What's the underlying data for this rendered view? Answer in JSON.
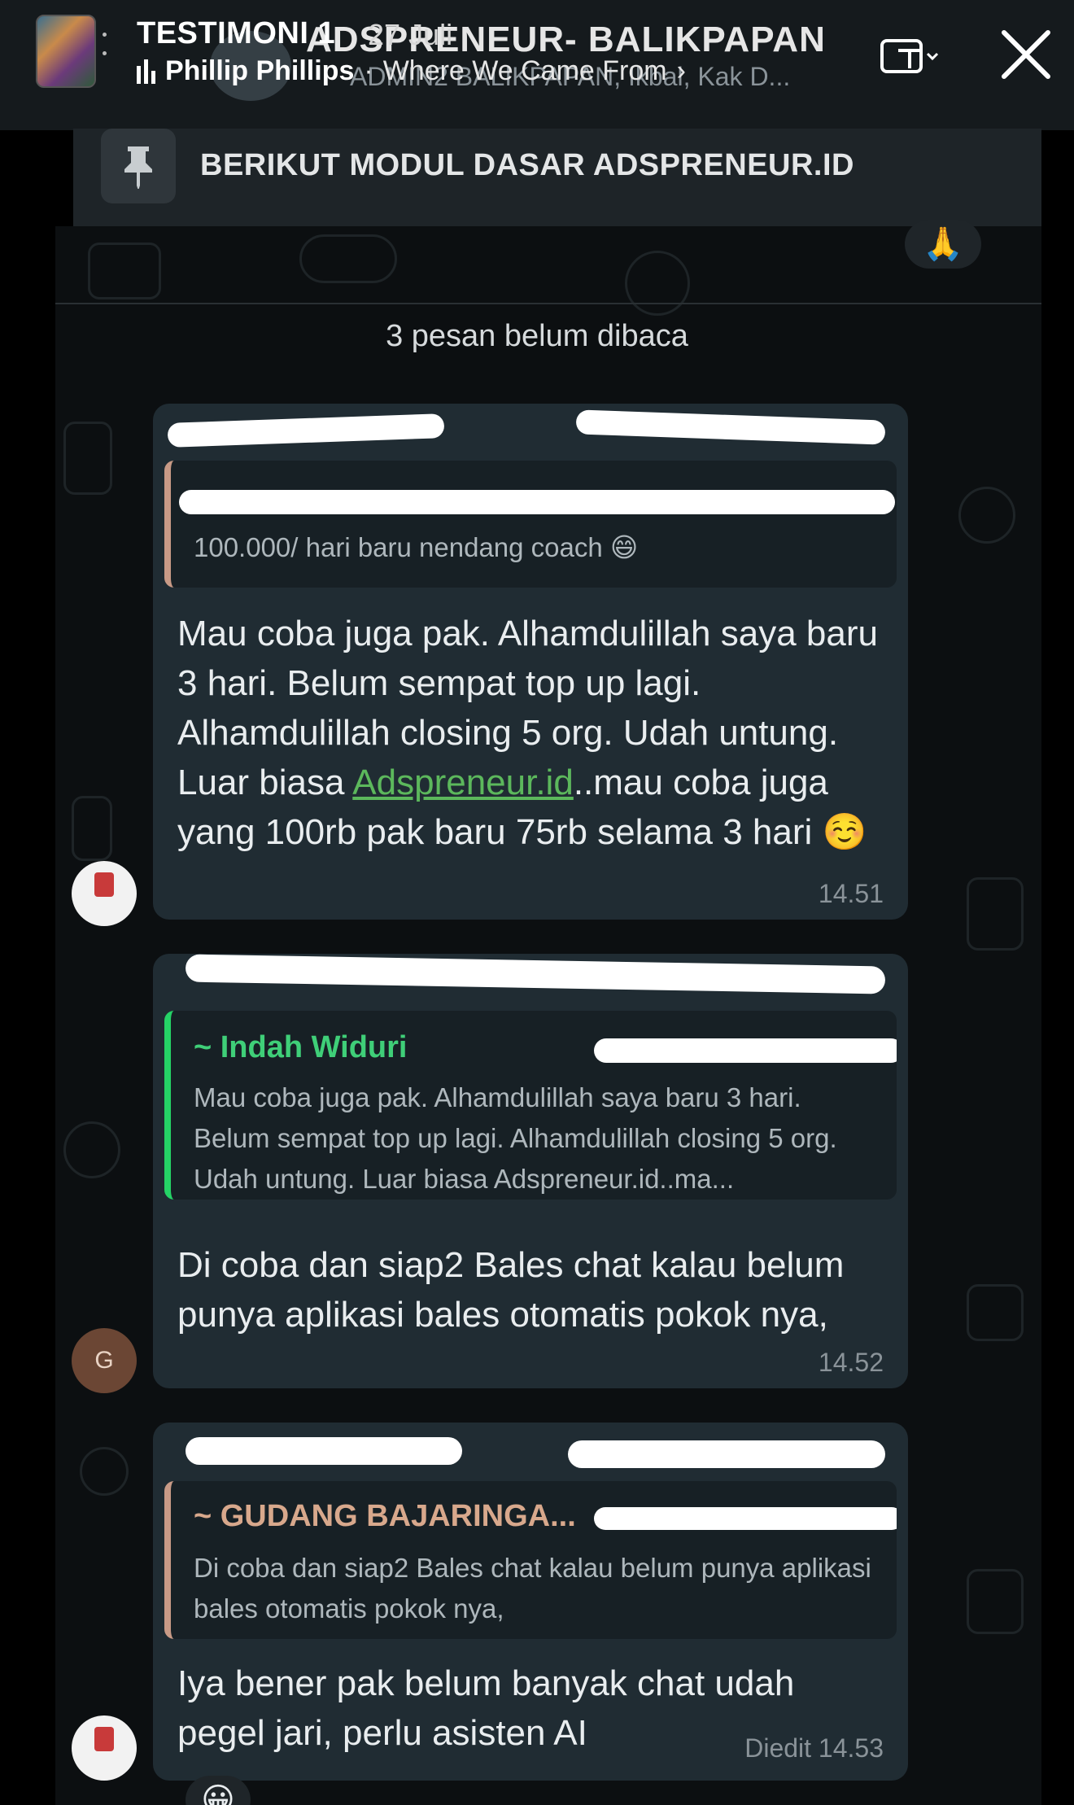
{
  "story": {
    "title": "TESTIMONI 1",
    "date": "27 Juli",
    "artist": "Phillip Phillips",
    "separator": " · ",
    "song": "Where We Came From",
    "chevron": "›"
  },
  "chat": {
    "group_name": "ADSPRENEUR- BALIKPAPAN",
    "group_subtitle": "ADMIN2  BALIKPAPAN, Ikbal, Kak D...",
    "pinned_text": "BERIKUT MODUL DASAR ADSPRENEUR.ID",
    "pinned_reaction": "🙏",
    "unread_label": "3 pesan belum dibaca",
    "messages": [
      {
        "quote_text": "100.000/ hari baru nendang coach 😄",
        "body_part1": "Mau coba juga pak. Alhamdulillah saya baru 3 hari. Belum sempat top up lagi. Alhamdulillah closing 5 org. Udah untung. Luar biasa ",
        "link": "Adspreneur.id",
        "body_part2": "..mau coba juga yang 100rb pak baru 75rb selama 3 hari ☺️",
        "time": "14.51"
      },
      {
        "avatar_letter": "G",
        "quote_author": "~ Indah Widuri",
        "quote_text": "Mau coba juga pak. Alhamdulillah saya baru 3 hari. Belum sempat top up lagi. Alhamdulillah closing 5 org. Udah untung.  Luar biasa Adspreneur.id..ma...",
        "body": "Di coba dan siap2 Bales chat kalau belum punya aplikasi bales otomatis pokok nya,",
        "time": "14.52"
      },
      {
        "quote_author": "~ GUDANG BAJARINGA...",
        "quote_text": "Di coba dan siap2 Bales chat kalau belum punya aplikasi bales otomatis pokok nya,",
        "body": "Iya bener pak belum banyak chat udah pegel jari, perlu asisten AI",
        "time": "Diedit 14.53"
      }
    ],
    "bottom_reaction": "😀"
  },
  "icons": {
    "story_avatar": "story-thumbnail",
    "music": "music-bars-icon",
    "action": "cast-icon",
    "close": "close-icon",
    "pin": "pin-icon"
  }
}
